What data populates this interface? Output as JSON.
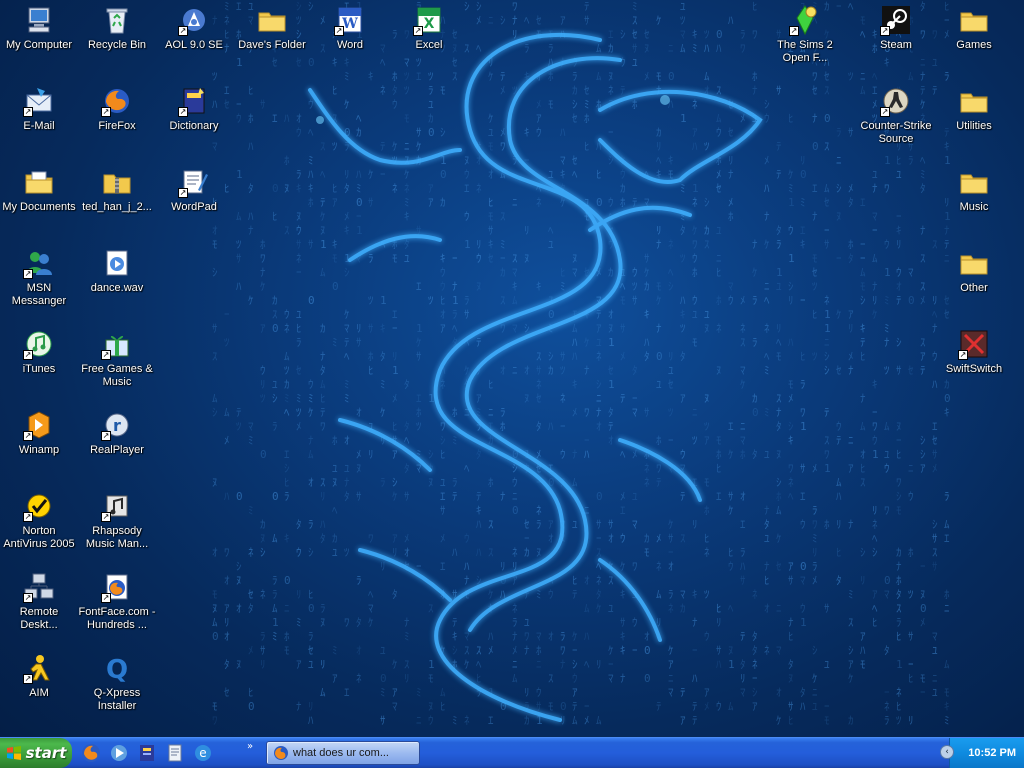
{
  "desktop": {
    "icons": [
      {
        "id": "my-computer",
        "label": "My Computer",
        "icon": "my-computer-icon",
        "shortcut": false
      },
      {
        "id": "recycle-bin",
        "label": "Recycle Bin",
        "icon": "recycle-bin-icon",
        "shortcut": false
      },
      {
        "id": "aol",
        "label": "AOL 9.0 SE",
        "icon": "aol-icon",
        "shortcut": true
      },
      {
        "id": "daves-folder",
        "label": "Dave's Folder",
        "icon": "folder-icon",
        "shortcut": false
      },
      {
        "id": "word",
        "label": "Word",
        "icon": "word-icon",
        "shortcut": true
      },
      {
        "id": "excel",
        "label": "Excel",
        "icon": "excel-icon",
        "shortcut": true
      },
      {
        "id": "sims2",
        "label": "The Sims 2 Open F...",
        "icon": "sims2-icon",
        "shortcut": true
      },
      {
        "id": "steam",
        "label": "Steam",
        "icon": "steam-icon",
        "shortcut": true
      },
      {
        "id": "games",
        "label": "Games",
        "icon": "folder-icon",
        "shortcut": false
      },
      {
        "id": "email",
        "label": "E-Mail",
        "icon": "email-icon",
        "shortcut": true
      },
      {
        "id": "firefox",
        "label": "FireFox",
        "icon": "firefox-icon",
        "shortcut": true
      },
      {
        "id": "dictionary",
        "label": "Dictionary",
        "icon": "dictionary-icon",
        "shortcut": true
      },
      {
        "id": "counter-strike",
        "label": "Counter-Strike Source",
        "icon": "counter-strike-icon",
        "shortcut": true
      },
      {
        "id": "utilities",
        "label": "Utilities",
        "icon": "folder-icon",
        "shortcut": false
      },
      {
        "id": "my-documents",
        "label": "My Documents",
        "icon": "my-documents-icon",
        "shortcut": false
      },
      {
        "id": "ted-han",
        "label": "ted_han_j_2...",
        "icon": "zip-folder-icon",
        "shortcut": false
      },
      {
        "id": "wordpad",
        "label": "WordPad",
        "icon": "wordpad-icon",
        "shortcut": true
      },
      {
        "id": "music",
        "label": "Music",
        "icon": "folder-icon",
        "shortcut": false
      },
      {
        "id": "msn",
        "label": "MSN Messanger",
        "icon": "msn-icon",
        "shortcut": true
      },
      {
        "id": "dance",
        "label": "dance.wav",
        "icon": "media-file-icon",
        "shortcut": false
      },
      {
        "id": "other",
        "label": "Other",
        "icon": "folder-icon",
        "shortcut": false
      },
      {
        "id": "itunes",
        "label": "iTunes",
        "icon": "itunes-icon",
        "shortcut": true
      },
      {
        "id": "free-games",
        "label": "Free Games & Music",
        "icon": "gift-icon",
        "shortcut": true
      },
      {
        "id": "swiftswitch",
        "label": "SwiftSwitch",
        "icon": "swiftswitch-icon",
        "shortcut": true
      },
      {
        "id": "winamp",
        "label": "Winamp",
        "icon": "winamp-icon",
        "shortcut": true
      },
      {
        "id": "realplayer",
        "label": "RealPlayer",
        "icon": "realplayer-icon",
        "shortcut": true
      },
      {
        "id": "norton",
        "label": "Norton AntiVirus 2005",
        "icon": "norton-icon",
        "shortcut": true
      },
      {
        "id": "rhapsody",
        "label": "Rhapsody Music Man...",
        "icon": "rhapsody-icon",
        "shortcut": true
      },
      {
        "id": "remote-desktop",
        "label": "Remote Deskt...",
        "icon": "remote-desktop-icon",
        "shortcut": true
      },
      {
        "id": "fontface",
        "label": "FontFace.com - Hundreds ...",
        "icon": "firefox-document-icon",
        "shortcut": true
      },
      {
        "id": "aim",
        "label": "AIM",
        "icon": "aim-icon",
        "shortcut": true
      },
      {
        "id": "qxpress",
        "label": "Q-Xpress Installer",
        "icon": "qxpress-icon",
        "shortcut": false
      }
    ]
  },
  "taskbar": {
    "start_label": "start",
    "quick_launch": [
      {
        "icon": "firefox-icon"
      },
      {
        "icon": "media-player-icon"
      },
      {
        "icon": "aol-dictionary-icon"
      },
      {
        "icon": "document-icon"
      },
      {
        "icon": "internet-explorer-icon"
      }
    ],
    "more_label": "»",
    "task_button_label": "what does ur com...",
    "clock": "10:52 PM"
  },
  "colors": {
    "wallpaper": "#0a3a7a",
    "dragon": "#3fb0ff",
    "taskbar": "#245edb",
    "start": "#3a9c3a",
    "tray": "#0f8be0"
  }
}
